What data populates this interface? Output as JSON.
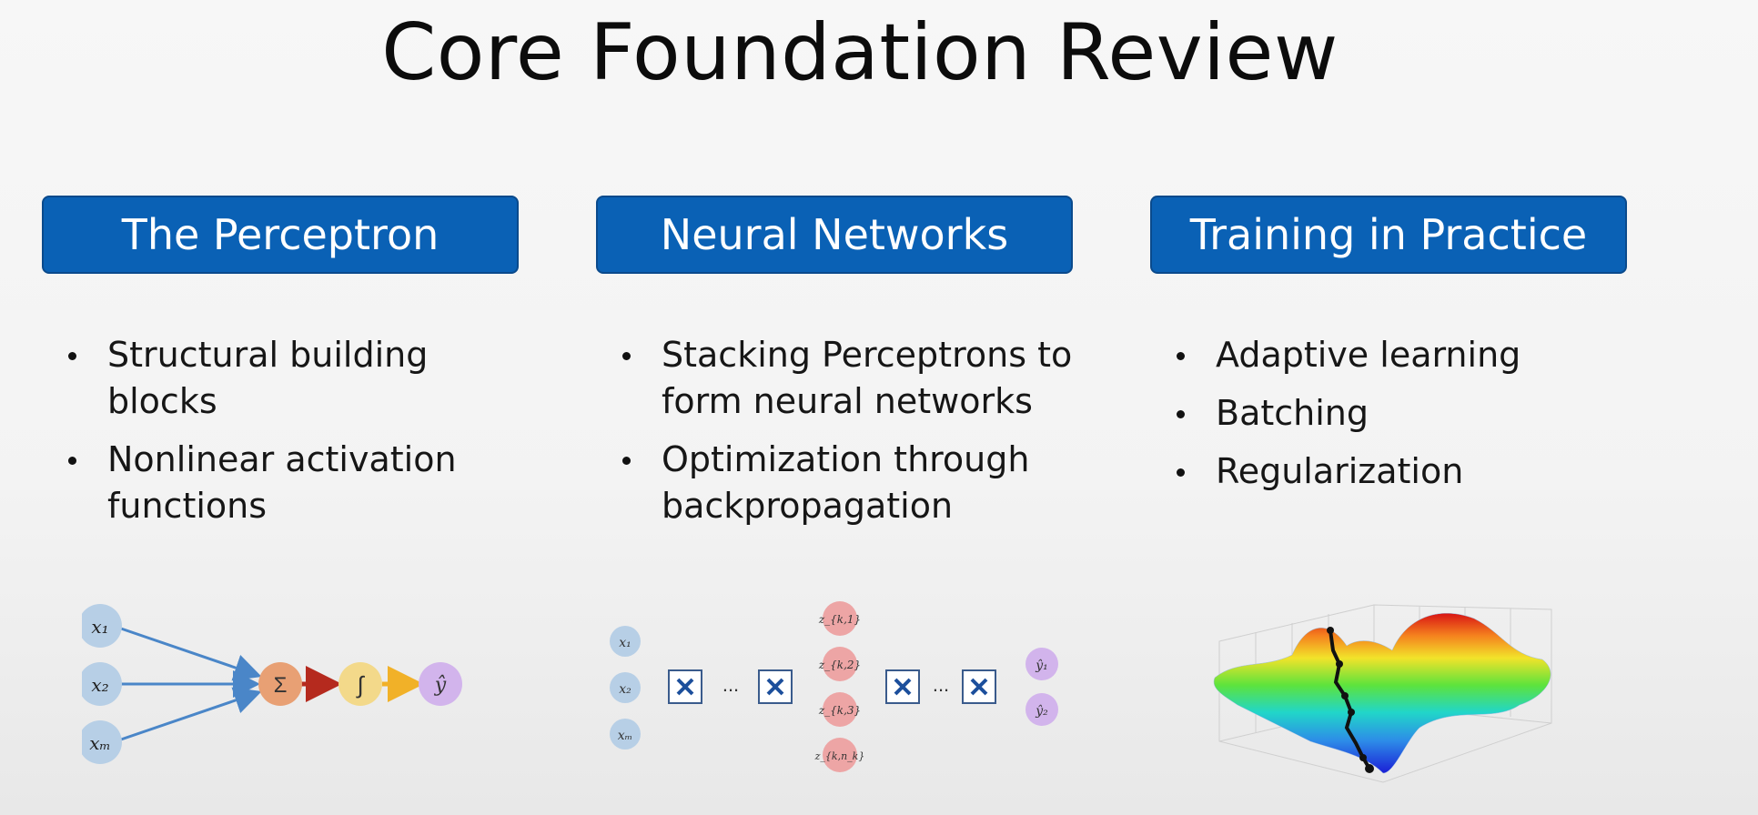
{
  "slide": {
    "title": "Core Foundation Review",
    "columns": [
      {
        "header": "The Perceptron",
        "bullets": [
          "Structural building blocks",
          "Nonlinear activation functions"
        ]
      },
      {
        "header": "Neural Networks",
        "bullets": [
          "Stacking Perceptrons to form neural networks",
          "Optimization through backpropagation"
        ]
      },
      {
        "header": "Training in Practice",
        "bullets": [
          "Adaptive learning",
          "Batching",
          "Regularization"
        ]
      }
    ]
  },
  "figures": {
    "perceptron": {
      "inputs": [
        "x₁",
        "x₂",
        "xₘ"
      ],
      "sum_symbol": "Σ",
      "activation_symbol": "∫",
      "output": "ŷ"
    },
    "network": {
      "inputs": [
        "x₁",
        "x₂",
        "xₘ"
      ],
      "ellipsis": "...",
      "hidden": [
        "z_{k,1}",
        "z_{k,2}",
        "z_{k,3}",
        "z_{k,n_k}"
      ],
      "outputs": [
        "ŷ₁",
        "ŷ₂"
      ]
    }
  },
  "colors": {
    "header_bg": "#0a61b5",
    "input_node": "#b7cfe6",
    "sum_node": "#e8a074",
    "activation_node": "#f3d98a",
    "output_node": "#d2b4ec",
    "hidden_node": "#eda5a5",
    "arrow_blue": "#4a86c8",
    "arrow_red": "#b52a1e",
    "arrow_orange": "#f1b128"
  }
}
